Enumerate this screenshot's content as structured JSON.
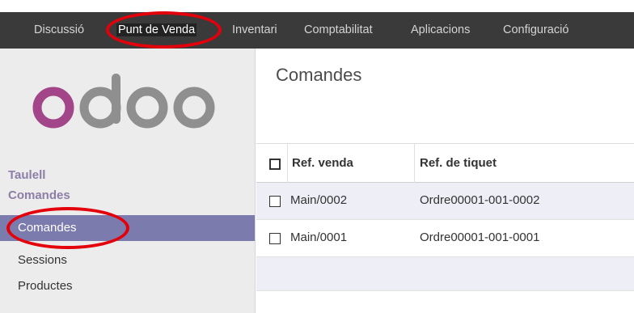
{
  "topbar": {
    "menus": [
      "Discussió",
      "Punt de Venda",
      "Inventari",
      "Comptabilitat",
      "Aplicacions",
      "Configuració"
    ],
    "active": "Punt de Venda"
  },
  "sidebar": {
    "logo_text": "odoo",
    "section_title": "Taulell",
    "section_title_2": "Comandes",
    "items": [
      {
        "label": "Comandes",
        "active": true
      },
      {
        "label": "Sessions",
        "active": false
      },
      {
        "label": "Productes",
        "active": false
      }
    ]
  },
  "main": {
    "title": "Comandes",
    "columns": [
      "Ref. venda",
      "Ref. de tiquet"
    ],
    "rows": [
      {
        "ref_venda": "Main/0002",
        "ref_tiquet": "Ordre00001-001-0002"
      },
      {
        "ref_venda": "Main/0001",
        "ref_tiquet": "Ordre00001-001-0001"
      }
    ]
  },
  "colors": {
    "topbar_bg": "#3a3a3a",
    "sidebar_bg": "#ececec",
    "active_item_bg": "#7c7bad",
    "section_title": "#8c7ea6",
    "annotation_red": "#e3000b",
    "logo_purple": "#a24689",
    "logo_grey": "#8f8f8f"
  }
}
